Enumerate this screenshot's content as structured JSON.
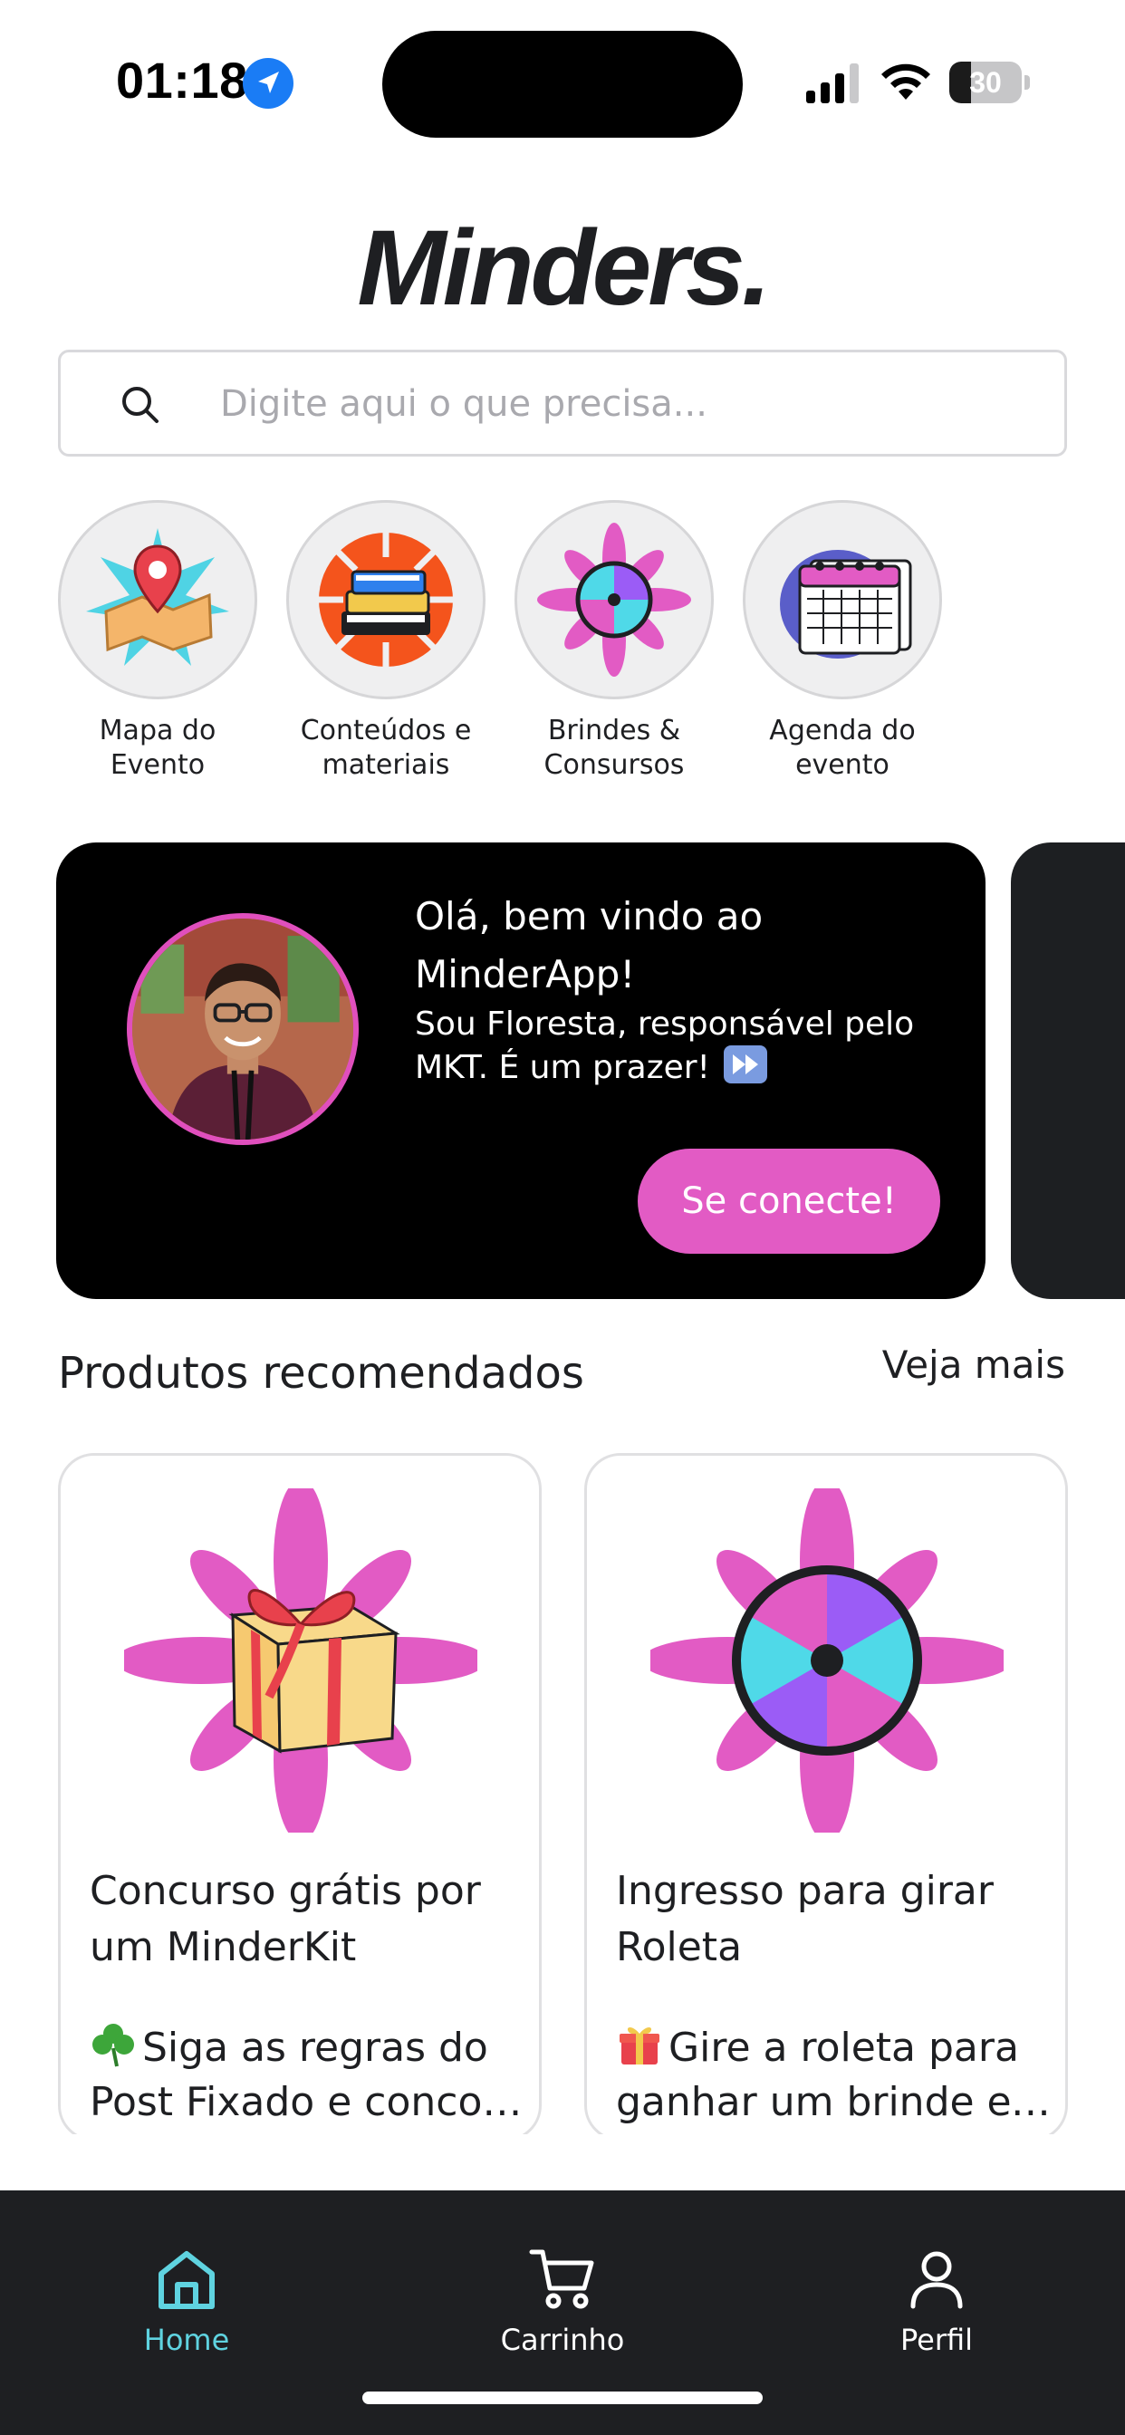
{
  "status_bar": {
    "time": "01:18",
    "battery_level": "30",
    "battery_percent": 30
  },
  "header": {
    "logo_text": "Minders."
  },
  "search": {
    "placeholder": "Digite aqui o que precisa..."
  },
  "categories": [
    {
      "label_line1": "Mapa do",
      "label_line2": "Evento",
      "icon": "map-pin-icon"
    },
    {
      "label_line1": "Conteúdos e",
      "label_line2": "materiais",
      "icon": "books-icon"
    },
    {
      "label_line1": "Brindes &",
      "label_line2": "Consursos",
      "icon": "prize-wheel-icon"
    },
    {
      "label_line1": "Agenda do",
      "label_line2": "evento",
      "icon": "calendar-icon"
    }
  ],
  "banner": {
    "title": "Olá, bem vindo ao MinderApp!",
    "subtitle": "Sou Floresta, responsável pelo MKT. É um prazer!",
    "button_label": "Se conecte!"
  },
  "recommended": {
    "title": "Produtos recomendados",
    "see_more": "Veja mais",
    "products": [
      {
        "name": "Concurso grátis por um MinderKit",
        "desc_line1": "Siga as regras do",
        "desc_line2": "Post Fixado e concorra a um MinderKit",
        "icon": "gift-box-icon"
      },
      {
        "name": "Ingresso para girar Roleta",
        "desc_line1": "Gire a roleta para",
        "desc_line2": "ganhar um brinde exclusivo",
        "icon": "prize-wheel-icon"
      }
    ]
  },
  "tabbar": {
    "tabs": [
      {
        "label": "Home",
        "icon": "home-icon",
        "active": true
      },
      {
        "label": "Carrinho",
        "icon": "cart-icon",
        "active": false
      },
      {
        "label": "Perfil",
        "icon": "user-icon",
        "active": false
      }
    ]
  },
  "colors": {
    "accent_pink": "#e25bc4",
    "active_tab": "#5fd3e0",
    "dark": "#1e1f22"
  }
}
